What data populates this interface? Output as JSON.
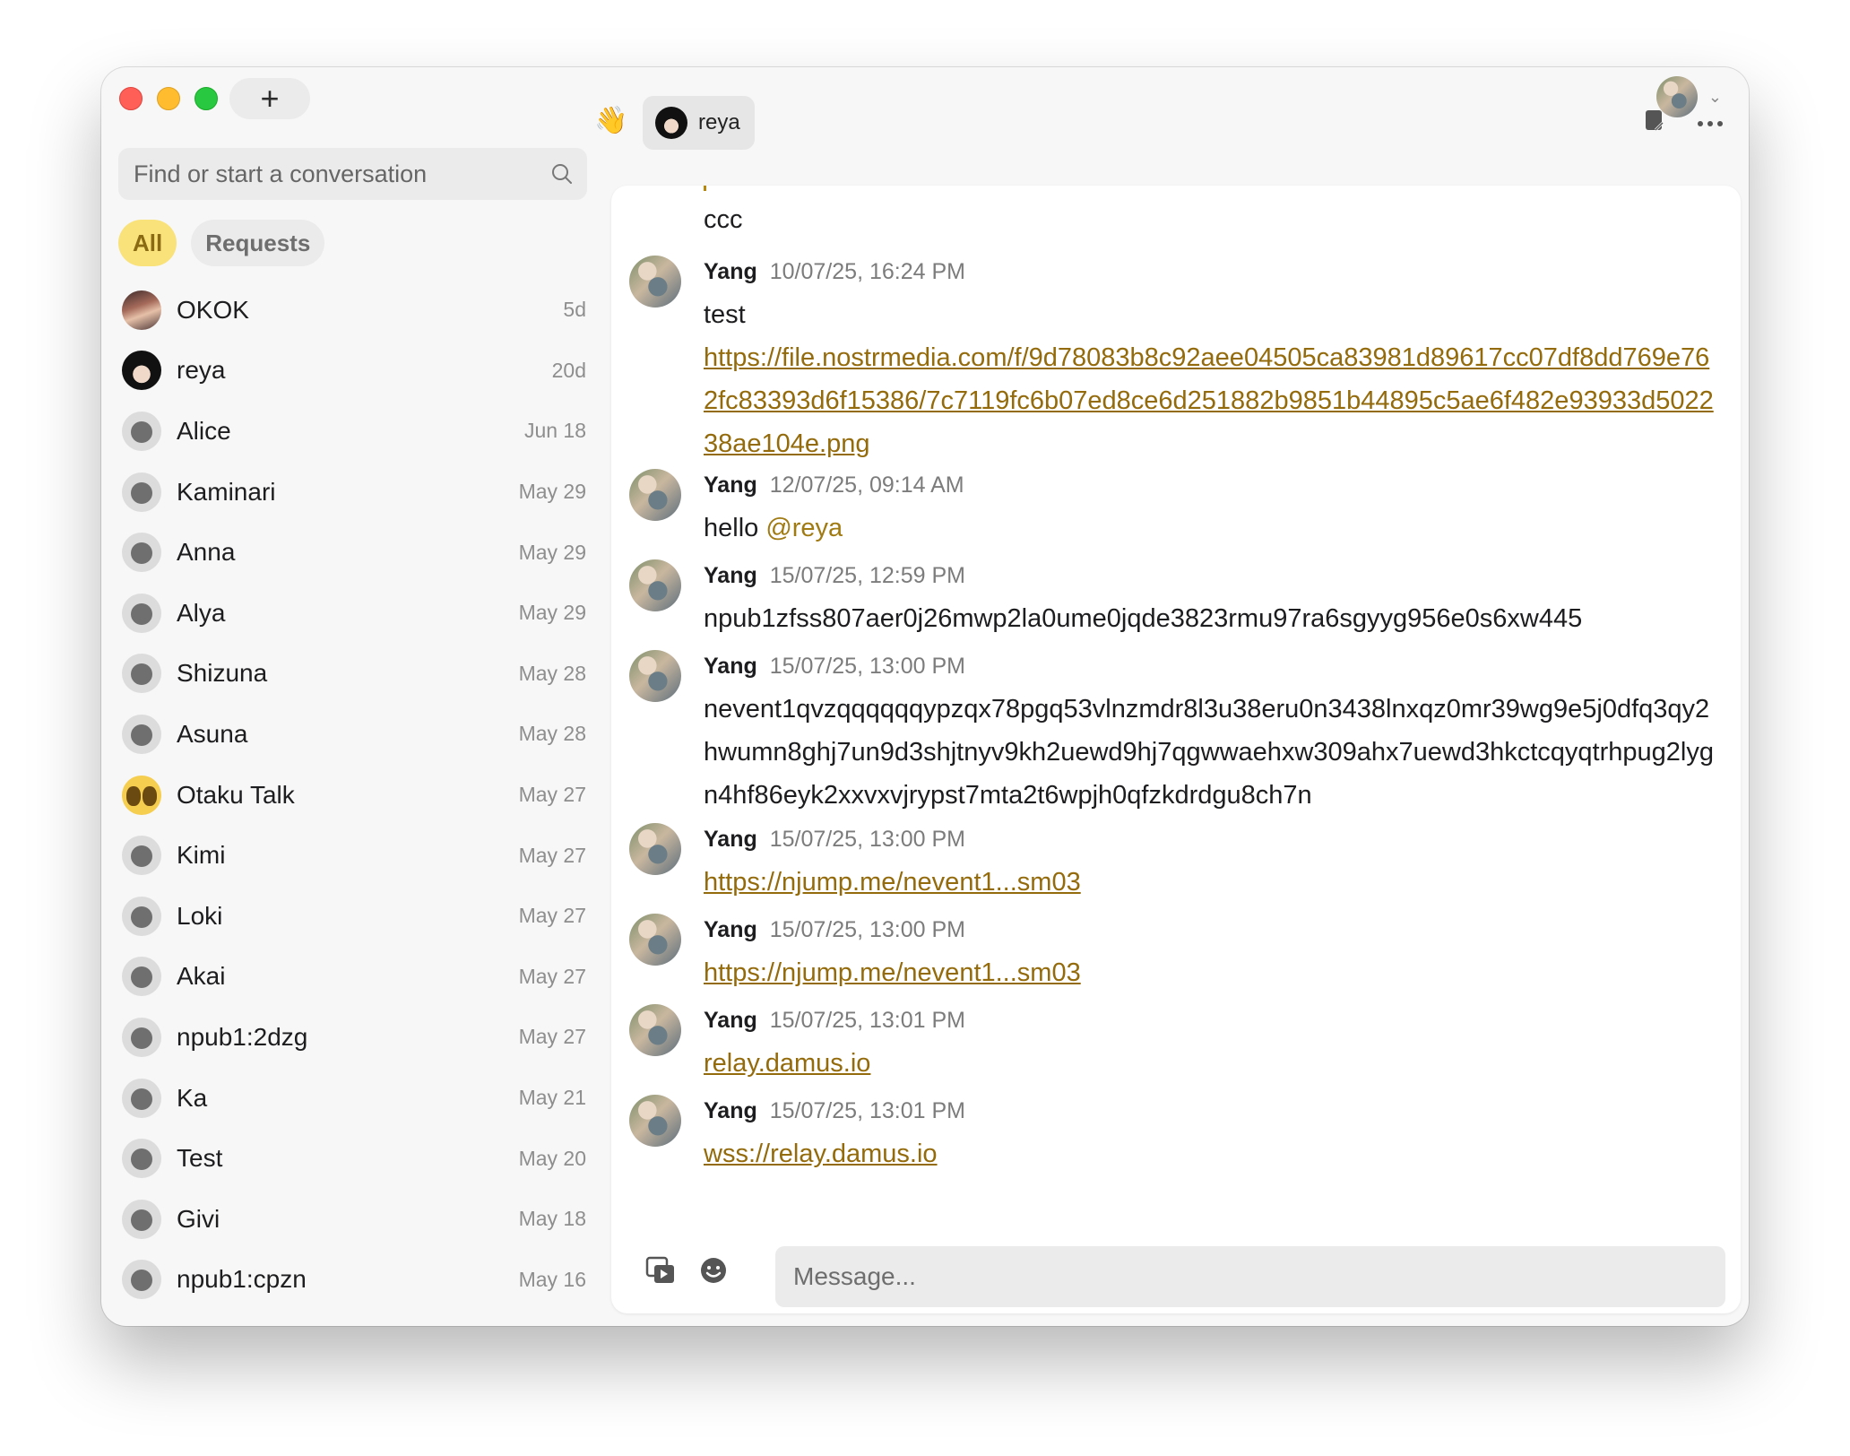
{
  "titlebar": {
    "new_label": "+"
  },
  "sidebar": {
    "search_placeholder": "Find or start a conversation",
    "filters": [
      "All",
      "Requests"
    ],
    "conversations": [
      {
        "name": "OKOK",
        "time": "5d"
      },
      {
        "name": "reya",
        "time": "20d"
      },
      {
        "name": "Alice",
        "time": "Jun 18"
      },
      {
        "name": "Kaminari",
        "time": "May 29"
      },
      {
        "name": "Anna",
        "time": "May 29"
      },
      {
        "name": "Alya",
        "time": "May 29"
      },
      {
        "name": "Shizuna",
        "time": "May 28"
      },
      {
        "name": "Asuna",
        "time": "May 28"
      },
      {
        "name": "Otaku Talk",
        "time": "May 27"
      },
      {
        "name": "Kimi",
        "time": "May 27"
      },
      {
        "name": "Loki",
        "time": "May 27"
      },
      {
        "name": "Akai",
        "time": "May 27"
      },
      {
        "name": "npub1:2dzg",
        "time": "May 27"
      },
      {
        "name": "Ka",
        "time": "May 21"
      },
      {
        "name": "Test",
        "time": "May 20"
      },
      {
        "name": "Givi",
        "time": "May 18"
      },
      {
        "name": "npub1:cpzn",
        "time": "May 16"
      }
    ]
  },
  "chat": {
    "header": {
      "wave": "👋",
      "chip_label": "reya"
    },
    "prev_text": "ccc",
    "messages": [
      {
        "author": "Yang",
        "time": "10/07/25, 16:24 PM",
        "text": "test",
        "link": "https://file.nostrmedia.com/f/9d78083b8c92aee04505ca83981d89617cc07df8dd769e762fc83393d6f15386/7c7119fc6b07ed8ce6d251882b9851b44895c5ae6f482e93933d502238ae104e.png"
      },
      {
        "author": "Yang",
        "time": "12/07/25, 09:14 AM",
        "text": "hello ",
        "mention": "@reya"
      },
      {
        "author": "Yang",
        "time": "15/07/25, 12:59 PM",
        "text": "npub1zfss807aer0j26mwp2la0ume0jqde3823rmu97ra6sgyyg956e0s6xw445"
      },
      {
        "author": "Yang",
        "time": "15/07/25, 13:00 PM",
        "text": "nevent1qvzqqqqqqypzqx78pgq53vlnzmdr8l3u38eru0n3438lnxqz0mr39wg9e5j0dfq3qy2hwumn8ghj7un9d3shjtnyv9kh2uewd9hj7qgwwaehxw309ahx7uewd3hkctcqyqtrhpug2lygn4hf86eyk2xxvxvjrypst7mta2t6wpjh0qfzkdrdgu8ch7n"
      },
      {
        "author": "Yang",
        "time": "15/07/25, 13:00 PM",
        "link": "https://njump.me/nevent1...sm03"
      },
      {
        "author": "Yang",
        "time": "15/07/25, 13:00 PM",
        "link": "https://njump.me/nevent1...sm03"
      },
      {
        "author": "Yang",
        "time": "15/07/25, 13:01 PM",
        "link": "relay.damus.io"
      },
      {
        "author": "Yang",
        "time": "15/07/25, 13:01 PM",
        "link": "wss://relay.damus.io"
      }
    ],
    "composer_placeholder": "Message..."
  },
  "colors": {
    "accent": "#946b0c",
    "pill_active": "#f9e27a"
  }
}
